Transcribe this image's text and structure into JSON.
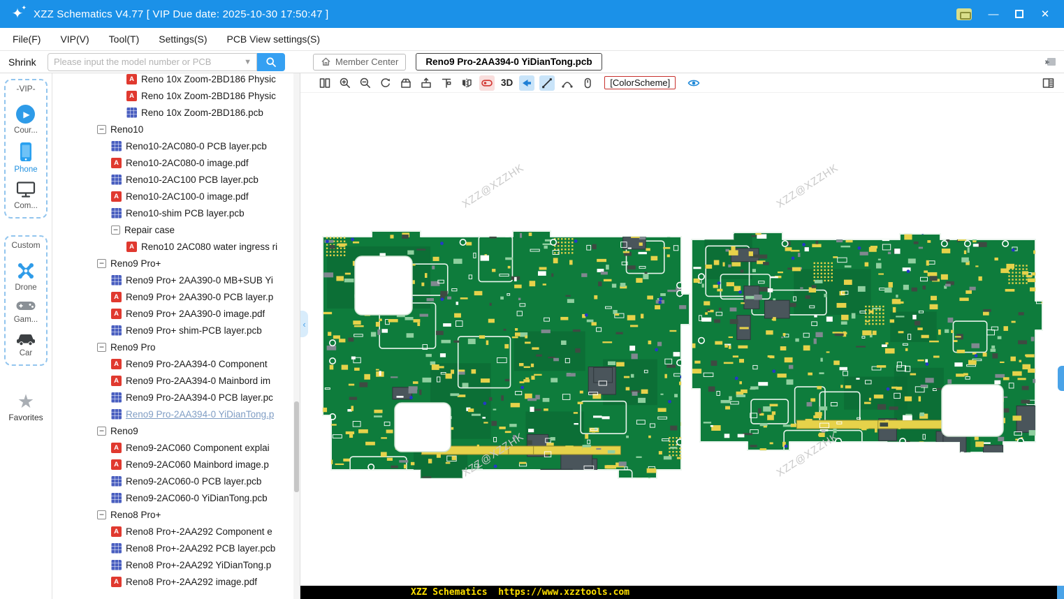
{
  "window": {
    "title": "XZZ Schematics V4.77 [ VIP Due date: 2025-10-30 17:50:47 ]",
    "controls": {
      "minimize": "—",
      "close": "✕"
    }
  },
  "menu": {
    "items": [
      "File(F)",
      "VIP(V)",
      "Tool(T)",
      "Settings(S)",
      "PCB View settings(S)"
    ]
  },
  "toolbar": {
    "shrink_label": "Shrink",
    "search_placeholder": "Please input the model number or PCB",
    "member_center_label": "Member Center",
    "open_tab_label": "Reno9 Pro-2AA394-0 YiDianTong.pcb"
  },
  "sidebar": {
    "vip_label": "-VIP-",
    "vip_items": [
      {
        "label": "Cour...",
        "icon": "play-icon"
      },
      {
        "label": "Phone",
        "icon": "phone-icon"
      },
      {
        "label": "Com...",
        "icon": "computer-icon"
      }
    ],
    "custom_label": "Custom",
    "custom_items": [
      {
        "label": "Drone",
        "icon": "drone-icon"
      },
      {
        "label": "Gam...",
        "icon": "gamepad-icon"
      },
      {
        "label": "Car",
        "icon": "car-icon"
      }
    ],
    "favorites_label": "Favorites"
  },
  "tree": {
    "items": [
      {
        "label": "Reno 10x Zoom-2BD186 Physic",
        "type": "pdf",
        "level": 3
      },
      {
        "label": "Reno 10x Zoom-2BD186 Physic",
        "type": "pdf",
        "level": 3
      },
      {
        "label": "Reno 10x Zoom-2BD186.pcb",
        "type": "pcb",
        "level": 3
      },
      {
        "label": "Reno10",
        "type": "node",
        "level": 1
      },
      {
        "label": "Reno10-2AC080-0 PCB layer.pcb",
        "type": "pcb",
        "level": 2
      },
      {
        "label": "Reno10-2AC080-0 image.pdf",
        "type": "pdf",
        "level": 2
      },
      {
        "label": "Reno10-2AC100 PCB layer.pcb",
        "type": "pcb",
        "level": 2
      },
      {
        "label": "Reno10-2AC100-0 image.pdf",
        "type": "pdf",
        "level": 2
      },
      {
        "label": "Reno10-shim PCB layer.pcb",
        "type": "pcb",
        "level": 2
      },
      {
        "label": "Repair case",
        "type": "node",
        "level": 2
      },
      {
        "label": "Reno10 2AC080 water ingress ri",
        "type": "pdf",
        "level": 3
      },
      {
        "label": "Reno9 Pro+",
        "type": "node",
        "level": 1
      },
      {
        "label": "Reno9 Pro+ 2AA390-0 MB+SUB Yi",
        "type": "pcb",
        "level": 2
      },
      {
        "label": "Reno9 Pro+ 2AA390-0 PCB layer.p",
        "type": "pdf",
        "level": 2
      },
      {
        "label": "Reno9 Pro+ 2AA390-0 image.pdf",
        "type": "pdf",
        "level": 2
      },
      {
        "label": "Reno9 Pro+ shim-PCB layer.pcb",
        "type": "pcb",
        "level": 2
      },
      {
        "label": "Reno9 Pro",
        "type": "node",
        "level": 1
      },
      {
        "label": "Reno9 Pro-2AA394-0 Component",
        "type": "pdf",
        "level": 2
      },
      {
        "label": "Reno9 Pro-2AA394-0 Mainbord im",
        "type": "pdf",
        "level": 2
      },
      {
        "label": "Reno9 Pro-2AA394-0 PCB layer.pc",
        "type": "pcb",
        "level": 2
      },
      {
        "label": "Reno9 Pro-2AA394-0 YiDianTong.p",
        "type": "pcb",
        "level": 2,
        "selected": true
      },
      {
        "label": "Reno9",
        "type": "node",
        "level": 1
      },
      {
        "label": "Reno9-2AC060 Component explai",
        "type": "pdf",
        "level": 2
      },
      {
        "label": "Reno9-2AC060 Mainbord image.p",
        "type": "pdf",
        "level": 2
      },
      {
        "label": "Reno9-2AC060-0 PCB layer.pcb",
        "type": "pcb",
        "level": 2
      },
      {
        "label": "Reno9-2AC060-0 YiDianTong.pcb",
        "type": "pcb",
        "level": 2
      },
      {
        "label": "Reno8 Pro+",
        "type": "node",
        "level": 1
      },
      {
        "label": "Reno8 Pro+-2AA292 Component e",
        "type": "pdf",
        "level": 2
      },
      {
        "label": "Reno8 Pro+-2AA292 PCB layer.pcb",
        "type": "pcb",
        "level": 2
      },
      {
        "label": "Reno8 Pro+-2AA292 YiDianTong.p",
        "type": "pcb",
        "level": 2
      },
      {
        "label": "Reno8 Pro+-2AA292 image.pdf",
        "type": "pdf",
        "level": 2
      }
    ]
  },
  "viewer": {
    "toolbar": {
      "label_3d": "3D",
      "colorscheme_label": "[ColorScheme]"
    },
    "watermark": "XZZ@XZZHK"
  },
  "statusbar": {
    "text": "XZZ Schematics  https://www.xzztools.com"
  },
  "colors": {
    "titlebar": "#1B91E8",
    "accent_blue": "#2E9BE8",
    "board_green": "#0E7C3C",
    "pad_yellow": "#E6D24A",
    "status_text": "#FFE000",
    "colorscheme_border": "#C8322E"
  }
}
